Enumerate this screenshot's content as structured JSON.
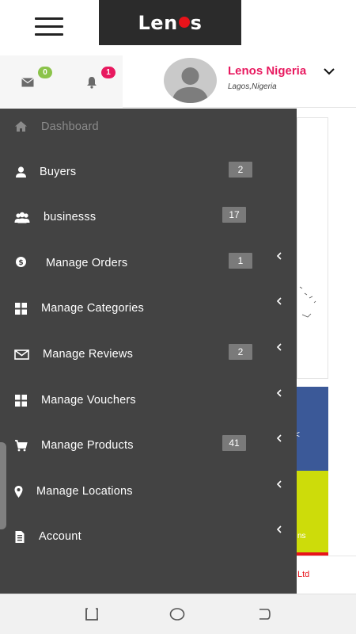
{
  "header": {
    "menu_icon": "hamburger-menu-icon",
    "logo_text_left": "Len",
    "logo_text_right": "s",
    "logo_dot_color": "#e8131a"
  },
  "userbar": {
    "messages_count": "0",
    "notifications_count": "1",
    "user_name": "Lenos Nigeria",
    "user_location": "Lagos,Nigeria",
    "name_color": "#e8195f"
  },
  "sidebar": {
    "background": "#434343",
    "items": [
      {
        "label": "Dashboard",
        "icon": "home-icon",
        "count": "",
        "has_submenu": false
      },
      {
        "label": "Buyers",
        "icon": "user-icon",
        "count": "2",
        "has_submenu": false
      },
      {
        "label": "businesss",
        "icon": "users-group-icon",
        "count": "17",
        "has_submenu": false
      },
      {
        "label": "Manage Orders",
        "icon": "dollar-circle-icon",
        "count": "1",
        "has_submenu": true
      },
      {
        "label": "Manage Categories",
        "icon": "grid-icon",
        "count": "",
        "has_submenu": true
      },
      {
        "label": "Manage Reviews",
        "icon": "envelope-icon",
        "count": "2",
        "has_submenu": true
      },
      {
        "label": "Manage Vouchers",
        "icon": "grid-icon",
        "count": "",
        "has_submenu": true
      },
      {
        "label": "Manage Products",
        "icon": "cart-icon",
        "count": "41",
        "has_submenu": true
      },
      {
        "label": "Manage Locations",
        "icon": "map-pin-icon",
        "count": "",
        "has_submenu": true
      },
      {
        "label": "Account",
        "icon": "document-icon",
        "count": "",
        "has_submenu": true
      }
    ]
  },
  "background_content": {
    "lime_text": "ns",
    "footer_text": "Ltd",
    "blue_char": "<"
  },
  "navbar": {
    "buttons": [
      "recent-apps-icon",
      "home-circle-icon",
      "back-icon"
    ]
  }
}
